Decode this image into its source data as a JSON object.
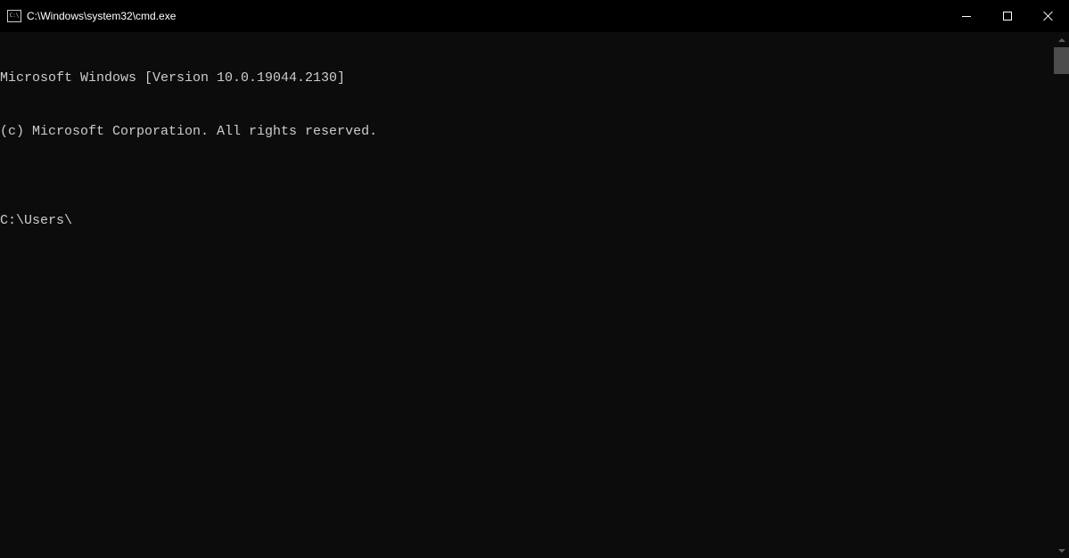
{
  "window": {
    "title": "C:\\Windows\\system32\\cmd.exe"
  },
  "terminal": {
    "line1": "Microsoft Windows [Version 10.0.19044.2130]",
    "line2": "(c) Microsoft Corporation. All rights reserved.",
    "blank": "",
    "prompt": "C:\\Users\\"
  }
}
